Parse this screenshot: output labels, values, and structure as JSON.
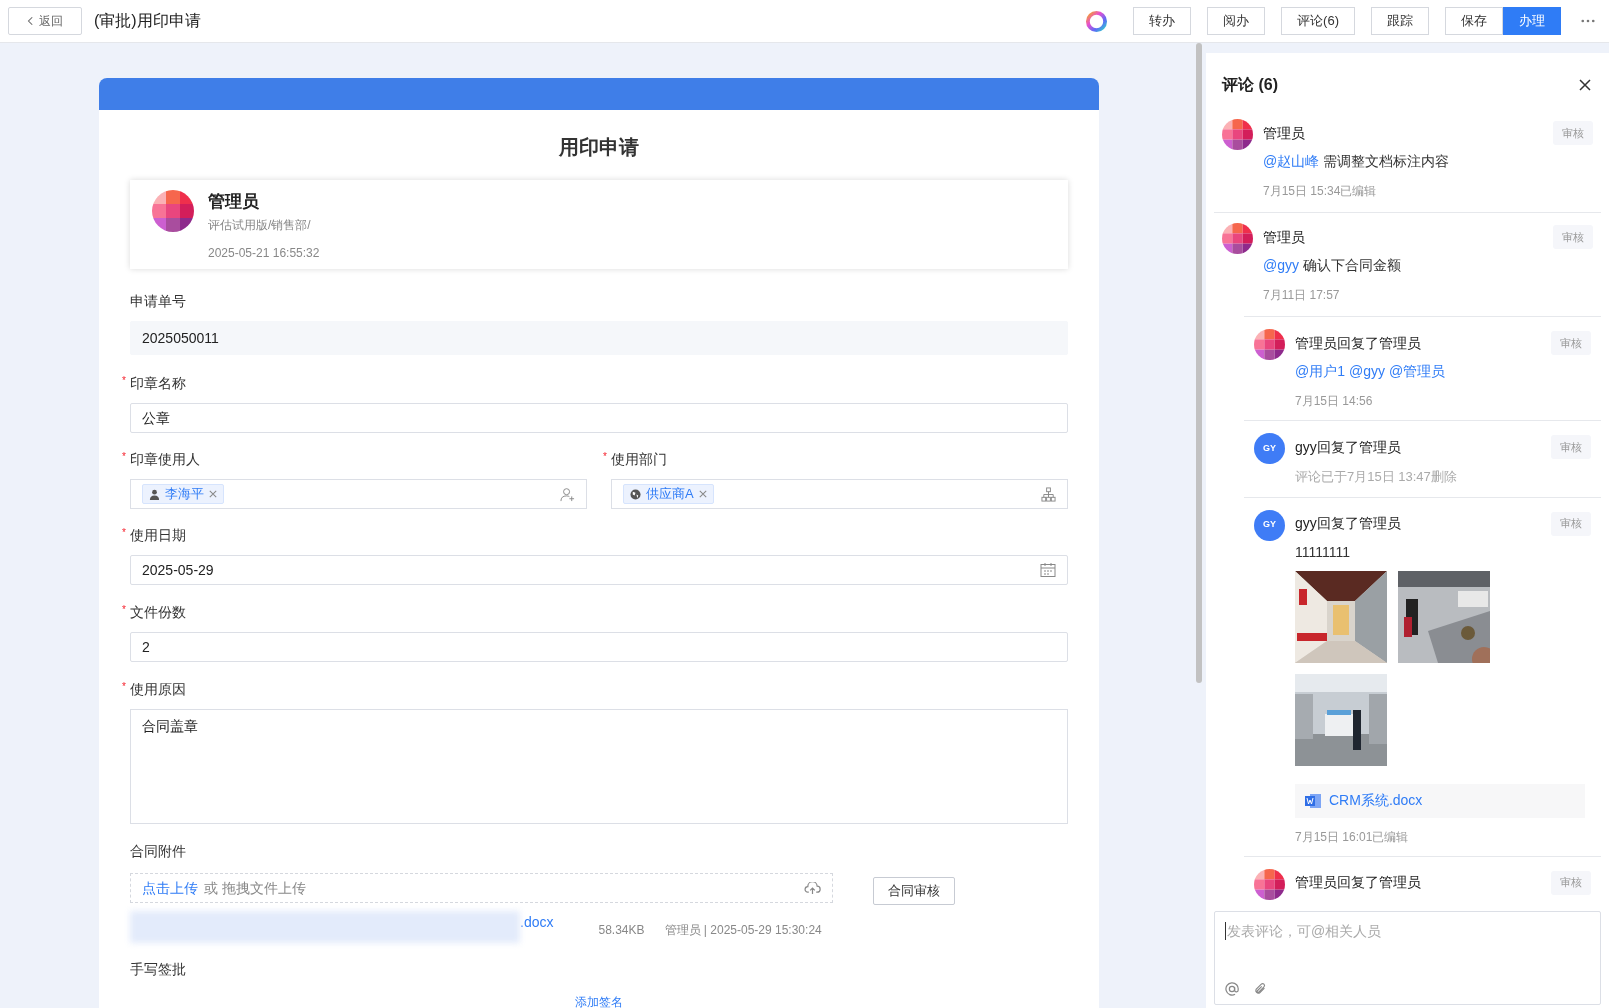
{
  "topbar": {
    "back": "返回",
    "title": "(审批)用印申请",
    "buttons": [
      {
        "label": "转办",
        "primary": false
      },
      {
        "label": "阅办",
        "primary": false
      },
      {
        "label": "评论(6)",
        "primary": false
      }
    ],
    "track": "跟踪",
    "save": {
      "label": "保存",
      "primary": false
    },
    "submit": {
      "label": "办理",
      "primary": true
    }
  },
  "form": {
    "title": "用印申请",
    "applicant": {
      "name": "管理员",
      "dept": "评估试用版/销售部/",
      "time": "2025-05-21 16:55:32"
    },
    "number": {
      "label": "申请单号",
      "value": "2025050011"
    },
    "seal_name": {
      "label": "印章名称",
      "value": "公章",
      "required_mark": "*"
    },
    "seal_user": {
      "label": "印章使用人",
      "tag": "李海平",
      "required_mark": "*"
    },
    "department": {
      "label": "使用部门",
      "tag": "供应商A",
      "required_mark": "*"
    },
    "date": {
      "label": "使用日期",
      "value": "2025-05-29",
      "required_mark": "*"
    },
    "copies": {
      "label": "文件份数",
      "value": "2",
      "required_mark": "*"
    },
    "reason": {
      "label": "使用原因",
      "value": "合同盖章",
      "required_mark": "*"
    },
    "attachment": {
      "label": "合同附件",
      "upload_link": "点击上传",
      "upload_hint": "或 拖拽文件上传",
      "review_button": "合同审核",
      "file": {
        "ext": ".docx",
        "size": "58.34KB",
        "meta": "管理员 | 2025-05-29 15:30:24"
      }
    },
    "signature": {
      "label": "手写签批",
      "add": "添加签名"
    }
  },
  "comments": {
    "title": "评论 (6)",
    "placeholder": "发表评论，可@相关人员",
    "items": [
      {
        "kind": "mosaic",
        "author": "管理员",
        "action": "审核",
        "body": [
          {
            "text": "@赵山峰",
            "mention": true
          },
          {
            "text": "需调整文档标注内容",
            "mention": false
          }
        ],
        "time": "7月15日 15:34已编辑"
      },
      {
        "kind": "mosaic",
        "author": "管理员",
        "action": "审核",
        "body": [
          {
            "text": "@gyy",
            "mention": true
          },
          {
            "text": "确认下合同金额",
            "mention": false
          }
        ],
        "time": "7月11日 17:57",
        "children": [
          {
            "kind": "mosaic",
            "author": "管理员回复了管理员",
            "action": "审核",
            "body": [
              {
                "text": "@用户1",
                "mention": true
              },
              {
                "text": "@gyy",
                "mention": true
              },
              {
                "text": "@管理员",
                "mention": true
              }
            ],
            "time": "7月15日 14:56"
          },
          {
            "kind": "initials",
            "initials": "GY",
            "author": "gyy回复了管理员",
            "action": "审核",
            "deleted": "评论已于7月15日 13:47删除"
          },
          {
            "kind": "initials",
            "initials": "GY",
            "author": "gyy回复了管理员",
            "action": "审核",
            "body": [
              {
                "text": "11111111",
                "mention": false
              }
            ],
            "images": [
              {
                "kind": "picture"
              },
              {
                "kind": "picture"
              },
              {
                "kind": "picture"
              }
            ],
            "file": "CRM系统.docx",
            "time": "7月15日 16:01已编辑"
          },
          {
            "kind": "mosaic",
            "author": "管理员回复了管理员",
            "action": "审核"
          }
        ]
      }
    ]
  }
}
